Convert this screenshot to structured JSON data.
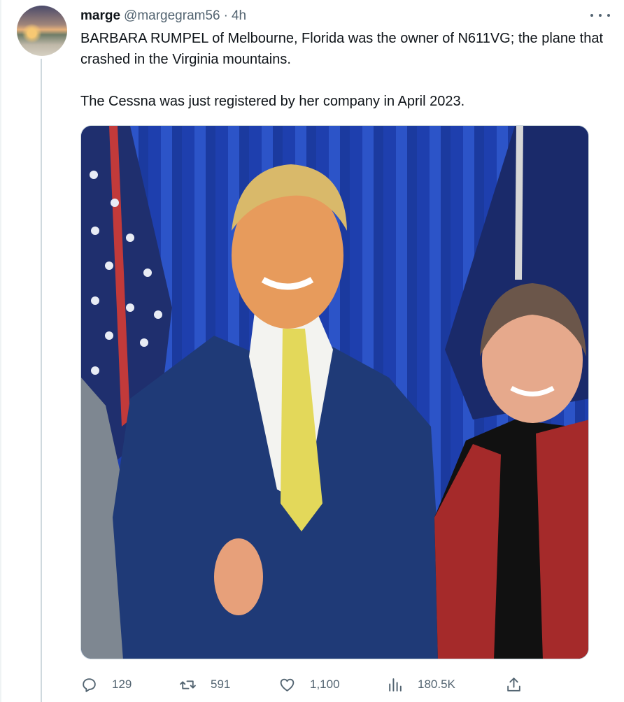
{
  "tweet": {
    "author_name": "marge",
    "handle": "@margegram56",
    "separator": "·",
    "time": "4h",
    "text_paragraph_1": "BARBARA RUMPEL of Melbourne, Florida was the owner of N611VG; the plane that crashed in the Virginia mountains.",
    "text_paragraph_2": "The Cessna was just registered by her company in April 2023.",
    "media_alt": "Photo of two people posing in front of a blue curtain with flags"
  },
  "actions": {
    "reply": {
      "icon": "reply-icon",
      "count": "129"
    },
    "retweet": {
      "icon": "retweet-icon",
      "count": "591"
    },
    "like": {
      "icon": "heart-icon",
      "count": "1,100"
    },
    "views": {
      "icon": "views-icon",
      "count": "180.5K"
    },
    "share": {
      "icon": "share-icon"
    }
  },
  "colors": {
    "text_primary": "#0f1419",
    "text_secondary": "#536471",
    "border": "#cfd9de",
    "curtain_blue": "#2c54c8"
  }
}
